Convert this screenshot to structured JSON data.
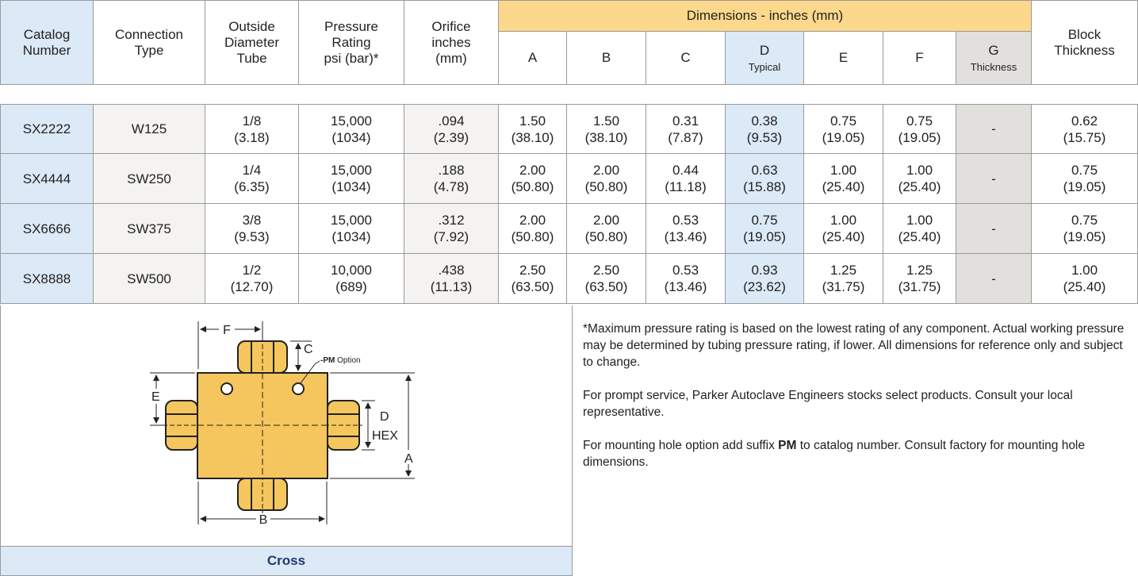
{
  "header": {
    "catalog_number": "Catalog\nNumber",
    "connection_type": "Connection\nType",
    "outside_diameter": "Outside\nDiameter\nTube",
    "pressure_rating": "Pressure\nRating\npsi (bar)*",
    "orifice": "Orifice\ninches\n(mm)",
    "dimensions_group": "Dimensions - inches (mm)",
    "dim_a": "A",
    "dim_b": "B",
    "dim_c": "C",
    "dim_d": "D",
    "dim_d_sub": "Typical",
    "dim_e": "E",
    "dim_f": "F",
    "dim_g": "G",
    "dim_g_sub": "Thickness",
    "block_thickness": "Block\nThickness"
  },
  "rows": [
    {
      "catalog": "SX2222",
      "connection": "W125",
      "od": "1/8\n(3.18)",
      "pressure": "15,000\n(1034)",
      "orifice": ".094\n(2.39)",
      "a": "1.50\n(38.10)",
      "b": "1.50\n(38.10)",
      "c": "0.31\n(7.87)",
      "d": "0.38\n(9.53)",
      "e": "0.75\n(19.05)",
      "f": "0.75\n(19.05)",
      "g": "-",
      "block": "0.62\n(15.75)"
    },
    {
      "catalog": "SX4444",
      "connection": "SW250",
      "od": "1/4\n(6.35)",
      "pressure": "15,000\n(1034)",
      "orifice": ".188\n(4.78)",
      "a": "2.00\n(50.80)",
      "b": "2.00\n(50.80)",
      "c": "0.44\n(11.18)",
      "d": "0.63\n(15.88)",
      "e": "1.00\n(25.40)",
      "f": "1.00\n(25.40)",
      "g": "-",
      "block": "0.75\n(19.05)"
    },
    {
      "catalog": "SX6666",
      "connection": "SW375",
      "od": "3/8\n(9.53)",
      "pressure": "15,000\n(1034)",
      "orifice": ".312\n(7.92)",
      "a": "2.00\n(50.80)",
      "b": "2.00\n(50.80)",
      "c": "0.53\n(13.46)",
      "d": "0.75\n(19.05)",
      "e": "1.00\n(25.40)",
      "f": "1.00\n(25.40)",
      "g": "-",
      "block": "0.75\n(19.05)"
    },
    {
      "catalog": "SX8888",
      "connection": "SW500",
      "od": "1/2\n(12.70)",
      "pressure": "10,000\n(689)",
      "orifice": ".438\n(11.13)",
      "a": "2.50\n(63.50)",
      "b": "2.50\n(63.50)",
      "c": "0.53\n(13.46)",
      "d": "0.93\n(23.62)",
      "e": "1.25\n(31.75)",
      "f": "1.25\n(31.75)",
      "g": "-",
      "block": "1.00\n(25.40)"
    }
  ],
  "notes": {
    "note1": "*Maximum pressure rating is based on the lowest rating of any component. Actual working pressure may be determined by tubing pressure rating, if lower. All dimensions for reference only and subject to change.",
    "note2": "For prompt service, Parker Autoclave Engineers stocks select products. Consult your local representative.",
    "note3_before": "For mounting hole option add suffix ",
    "note3_bold": "PM",
    "note3_after": " to catalog number. Consult factory for mounting hole dimensions."
  },
  "figure": {
    "label_f": "F",
    "label_c": "C",
    "label_pm_bold": "-PM",
    "label_pm_rest": " Option",
    "label_e": "E",
    "label_d": "D",
    "label_hex": "HEX",
    "label_a": "A",
    "label_b": "B",
    "caption": "Cross"
  },
  "colors": {
    "header_blue": "#dce9f6",
    "header_orange": "#fcd88c",
    "header_gray": "#e2e0dd",
    "brass": "#f5c65e",
    "caption_text": "#1f3a6e"
  }
}
